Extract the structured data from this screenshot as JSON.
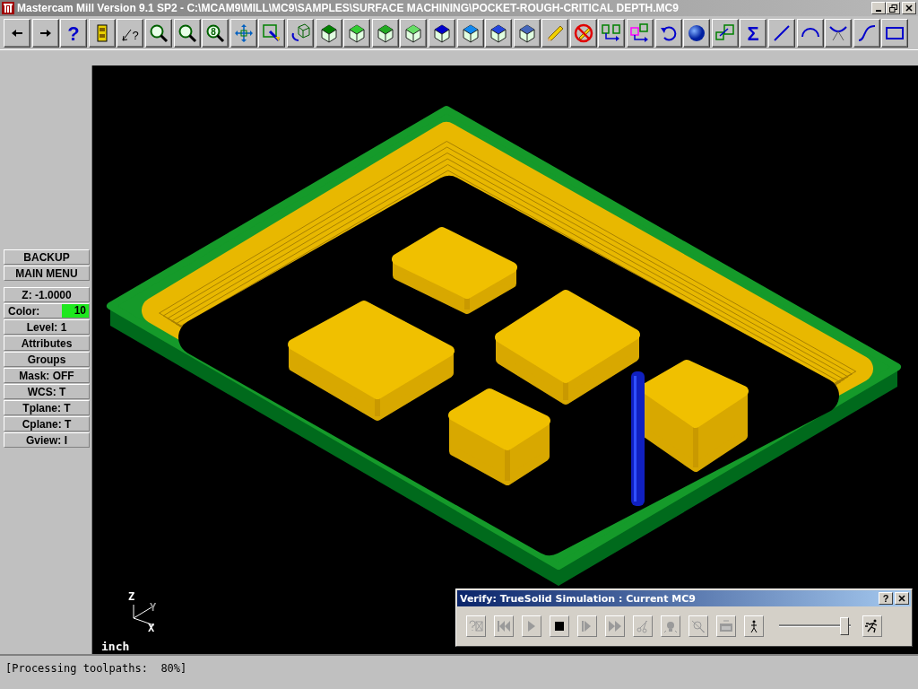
{
  "window": {
    "title": "Mastercam Mill Version 9.1 SP2 - C:\\MCAM9\\MILL\\MC9\\SAMPLES\\SURFACE MACHINING\\POCKET-ROUGH-CRITICAL DEPTH.MC9"
  },
  "toolbar": [
    {
      "kind": "back"
    },
    {
      "kind": "forward"
    },
    {
      "kind": "glyph",
      "glyph": "?"
    },
    {
      "kind": "cabinet"
    },
    {
      "kind": "pointer",
      "glyph": "?"
    },
    {
      "kind": "magnifier"
    },
    {
      "kind": "magnifier"
    },
    {
      "kind": "magnifier",
      "glyph": "8"
    },
    {
      "kind": "pan"
    },
    {
      "kind": "select"
    },
    {
      "kind": "rotate"
    },
    {
      "kind": "cube",
      "color": "#008000"
    },
    {
      "kind": "cube",
      "color": "#33cc33"
    },
    {
      "kind": "cube",
      "color": "#22aa22"
    },
    {
      "kind": "cube",
      "color": "#66dd66"
    },
    {
      "kind": "cube",
      "color": "#0000cc"
    },
    {
      "kind": "cube",
      "color": "#1188ee"
    },
    {
      "kind": "cube",
      "color": "#2244dd"
    },
    {
      "kind": "cube",
      "color": "#4466bb"
    },
    {
      "kind": "pencil"
    },
    {
      "kind": "no-pencil"
    },
    {
      "kind": "translate"
    },
    {
      "kind": "copy"
    },
    {
      "kind": "undo"
    },
    {
      "kind": "sphere"
    },
    {
      "kind": "scale"
    },
    {
      "kind": "glyph",
      "glyph": "Σ"
    },
    {
      "kind": "line"
    },
    {
      "kind": "arc"
    },
    {
      "kind": "fillet"
    },
    {
      "kind": "spline"
    },
    {
      "kind": "rectangle"
    }
  ],
  "sidebar": {
    "groups": [
      [
        {
          "kind": "button",
          "label": "BACKUP"
        },
        {
          "kind": "button",
          "label": "MAIN MENU"
        }
      ],
      [
        {
          "kind": "button",
          "label": "Z: -1.0000"
        },
        {
          "kind": "swatch",
          "label": "Color:",
          "value": "10",
          "color": "#1ee81e"
        },
        {
          "kind": "button",
          "label": "Level: 1"
        },
        {
          "kind": "button",
          "label": "Attributes"
        },
        {
          "kind": "button",
          "label": "Groups"
        },
        {
          "kind": "button",
          "label": "Mask: OFF"
        },
        {
          "kind": "button",
          "label": "WCS: T"
        },
        {
          "kind": "button",
          "label": "Tplane: T"
        },
        {
          "kind": "button",
          "label": "Cplane: T"
        },
        {
          "kind": "button",
          "label": "Gview: I"
        }
      ]
    ]
  },
  "viewport": {
    "axes": {
      "z": "Z",
      "y": "Y",
      "x": "X"
    },
    "units": "inch"
  },
  "verify_dialog": {
    "title": "Verify: TrueSolid Simulation : Current MC9",
    "help_button": "?",
    "buttons": [
      {
        "kind": "help-image",
        "disabled": true
      },
      {
        "kind": "rewind",
        "disabled": true
      },
      {
        "kind": "play",
        "disabled": true
      },
      {
        "kind": "stop",
        "disabled": false
      },
      {
        "kind": "step",
        "disabled": true
      },
      {
        "kind": "fast-forward",
        "disabled": true
      },
      {
        "kind": "scissors",
        "disabled": true
      },
      {
        "kind": "bulb",
        "disabled": true
      },
      {
        "kind": "magnify",
        "disabled": true
      },
      {
        "kind": "screen",
        "disabled": true
      },
      {
        "kind": "walk",
        "disabled": false
      }
    ],
    "speed_slider": {
      "level": 0.97
    }
  },
  "status_bar": {
    "text": "[Processing toolpaths:  80%]"
  }
}
